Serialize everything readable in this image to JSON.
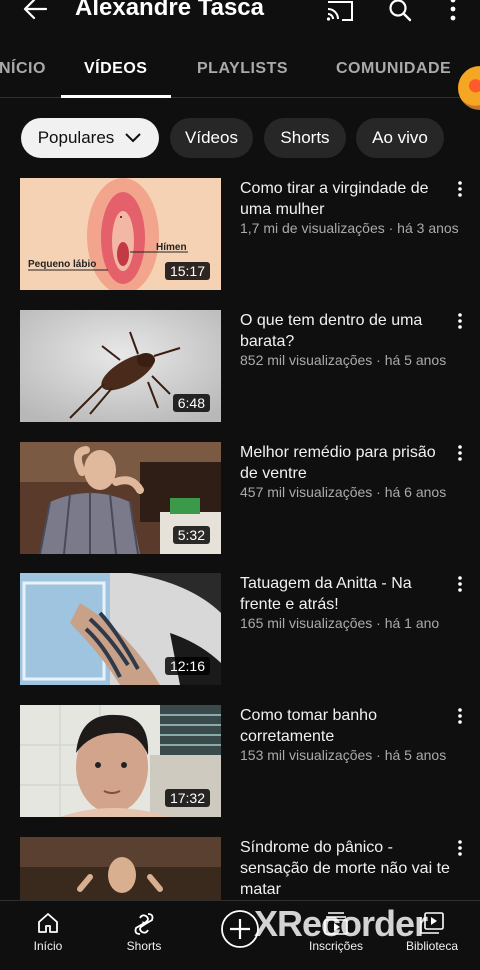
{
  "header": {
    "channel_name": "Alexandre Tasca"
  },
  "tabs": [
    {
      "label": "INÍCIO"
    },
    {
      "label": "VÍDEOS"
    },
    {
      "label": "PLAYLISTS"
    },
    {
      "label": "COMUNIDADE"
    }
  ],
  "active_tab": "VÍDEOS",
  "chips": [
    {
      "label": "Populares"
    },
    {
      "label": "Vídeos"
    },
    {
      "label": "Shorts"
    },
    {
      "label": "Ao vivo"
    }
  ],
  "videos": [
    {
      "title": "Como tirar a virgindade de uma mulher",
      "meta": "1,7 mi de visualizações · há 3 anos",
      "duration": "15:17",
      "thumb_labels": {
        "a": "Hímen",
        "b": "Pequeno lábio"
      }
    },
    {
      "title": "O que tem dentro de uma barata?",
      "meta": "852 mil visualizações · há 5 anos",
      "duration": "6:48"
    },
    {
      "title": "Melhor remédio para prisão de ventre",
      "meta": "457 mil visualizações · há 6 anos",
      "duration": "5:32"
    },
    {
      "title": "Tatuagem da Anitta - Na frente e atrás!",
      "meta": "165 mil visualizações · há 1 ano",
      "duration": "12:16"
    },
    {
      "title": "Como tomar banho corretamente",
      "meta": "153 mil visualizações · há 5 anos",
      "duration": "17:32"
    },
    {
      "title": "Síndrome do pânico - sensação de morte não vai te matar",
      "meta": "",
      "duration": ""
    }
  ],
  "bottom_nav": [
    {
      "label": "Início",
      "icon": "home-icon"
    },
    {
      "label": "Shorts",
      "icon": "shorts-icon"
    },
    {
      "label": "",
      "icon": "create-icon"
    },
    {
      "label": "Inscrições",
      "icon": "subscriptions-icon"
    },
    {
      "label": "Biblioteca",
      "icon": "library-icon"
    }
  ],
  "watermark": "XRecorder",
  "colors": {
    "background": "#0f0f0f",
    "chip": "#272727",
    "chip_selected": "#f1f1f1",
    "secondary_text": "#aaaaaa"
  }
}
